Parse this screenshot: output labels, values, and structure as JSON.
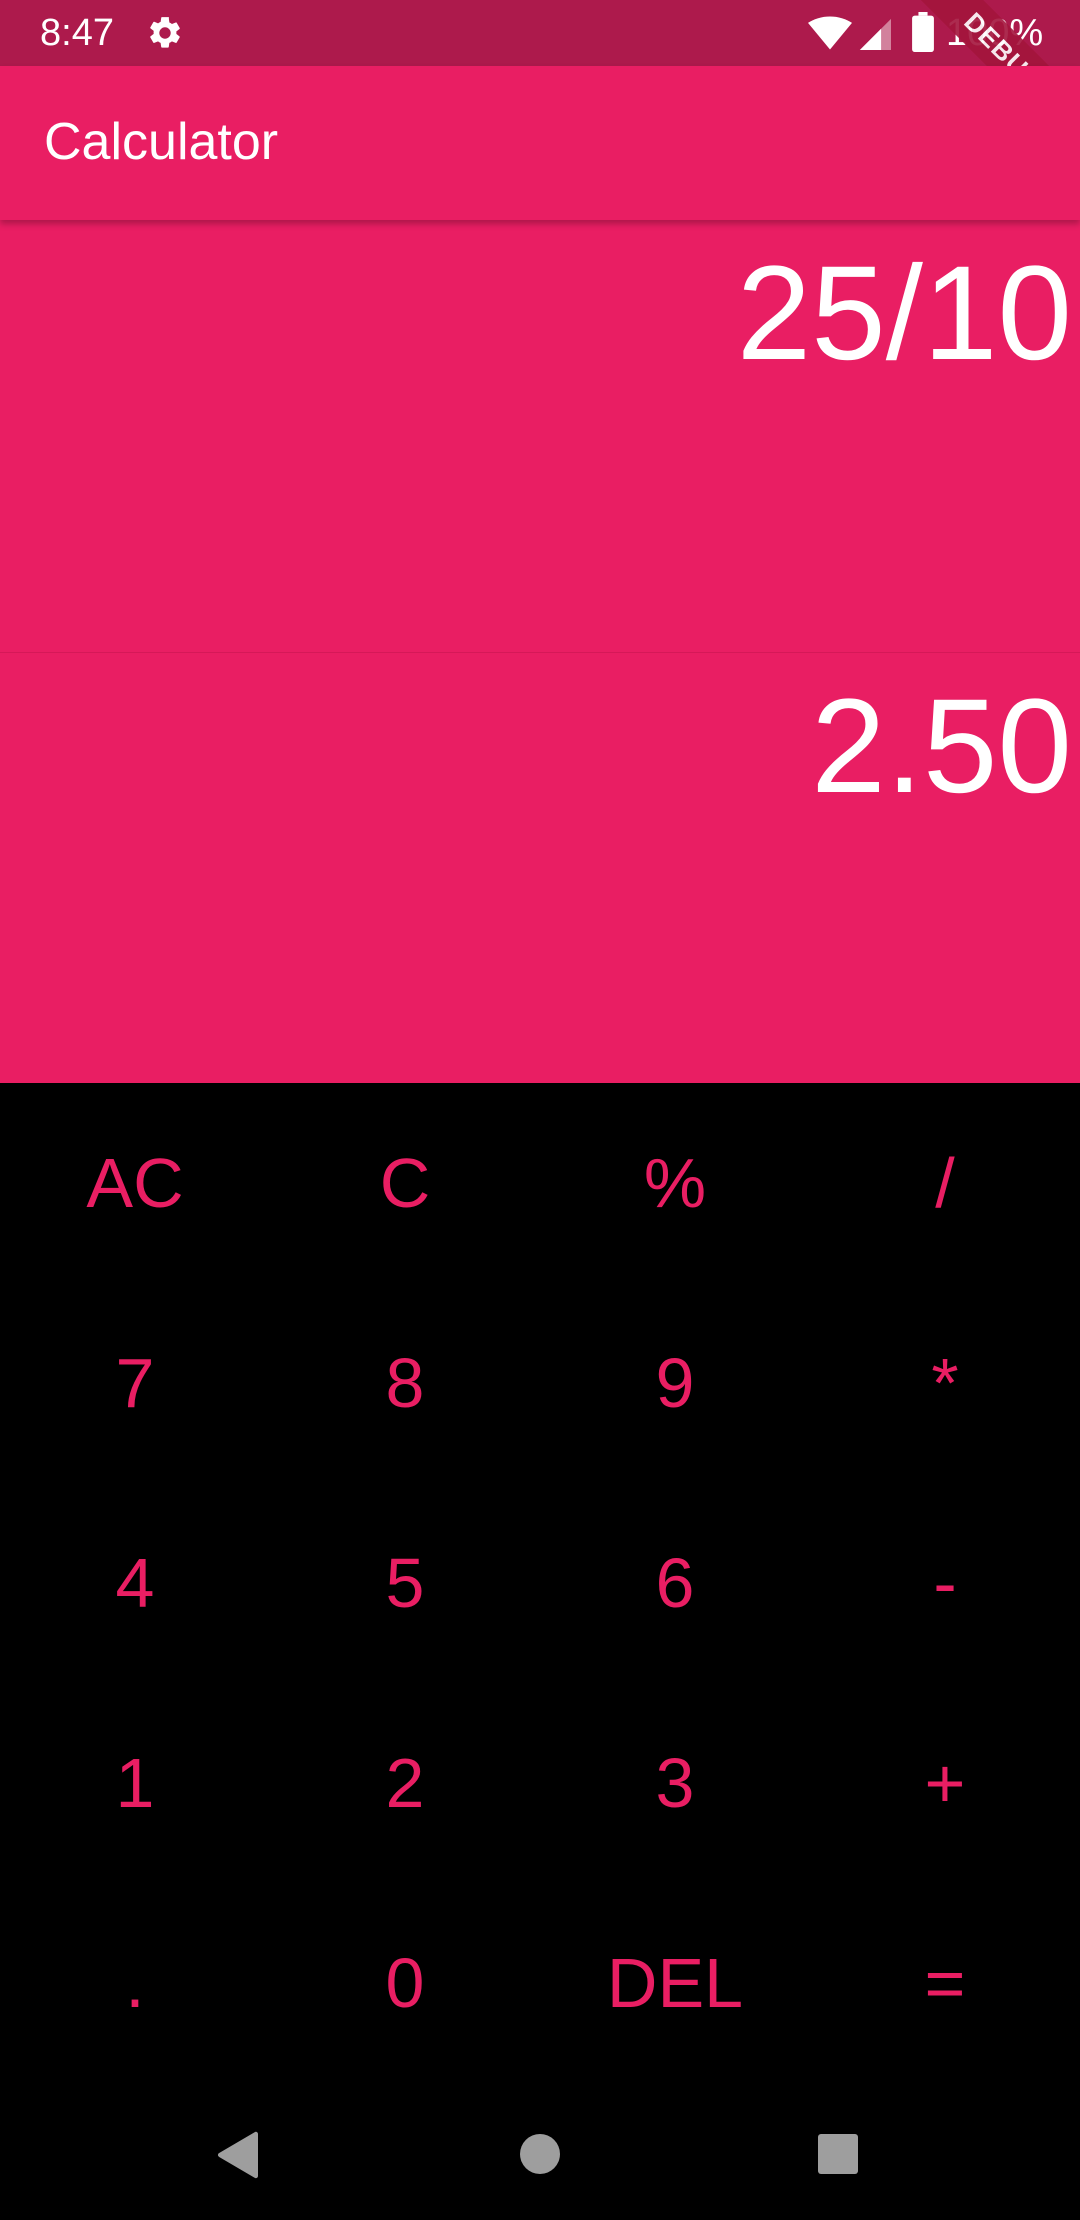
{
  "status_bar": {
    "time": "8:47",
    "battery_text": "100%",
    "background": "#AD1A4C",
    "icons": [
      "gear-icon",
      "wifi-icon",
      "cell-signal-icon",
      "battery-icon"
    ]
  },
  "debug_banner": {
    "label": "DEBUG"
  },
  "app_bar": {
    "title": "Calculator",
    "background": "#E91E63"
  },
  "display": {
    "expression": "25/10",
    "result": "2.50"
  },
  "keypad": {
    "key_color": "#E91E63",
    "rows": [
      [
        "AC",
        "C",
        "%",
        "/"
      ],
      [
        "7",
        "8",
        "9",
        "*"
      ],
      [
        "4",
        "5",
        "6",
        "-"
      ],
      [
        "1",
        "2",
        "3",
        "+"
      ],
      [
        ".",
        "0",
        "DEL",
        "="
      ]
    ]
  },
  "nav_bar": {
    "icons": [
      "back-icon",
      "home-icon",
      "recents-icon"
    ],
    "icon_color": "#9E9E9E"
  }
}
